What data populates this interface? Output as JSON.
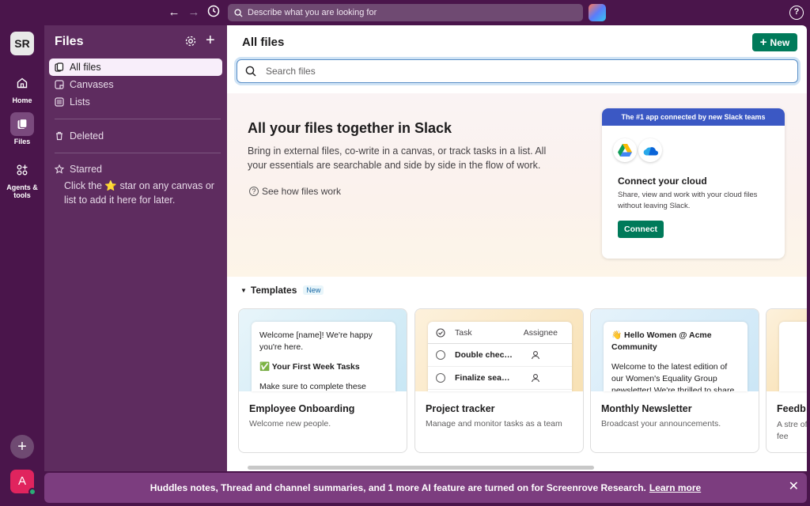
{
  "topbar": {
    "search_placeholder": "Describe what you are looking for",
    "help": "?"
  },
  "rail": {
    "user_initials": "SR",
    "home": "Home",
    "files": "Files",
    "agents": "Agents & tools",
    "plus": "+",
    "account_initial": "A"
  },
  "sidebar": {
    "title": "Files",
    "items": [
      {
        "label": "All files"
      },
      {
        "label": "Canvases"
      },
      {
        "label": "Lists"
      },
      {
        "label": "Deleted"
      },
      {
        "label": "Starred"
      }
    ],
    "starred_hint_pre": "Click the ",
    "starred_hint_star": "⭐",
    "starred_hint_post": " star on any canvas or list to add it here for later."
  },
  "main": {
    "title": "All files",
    "new_label": "New",
    "search_placeholder": "Search files",
    "hero": {
      "title": "All your files together in Slack",
      "desc": "Bring in external files, co-write in a canvas, or track tasks in a list. All your essentials are searchable and side by side in the flow of work.",
      "link": "See how files work"
    },
    "cloud_card": {
      "header": "The #1 app connected by new Slack teams",
      "title": "Connect your cloud",
      "desc": "Share, view and work with your cloud files without leaving Slack.",
      "button": "Connect"
    },
    "templates": {
      "label": "Templates",
      "badge": "New",
      "cards": [
        {
          "name": "Employee Onboarding",
          "desc": "Welcome new people.",
          "preview_line1": "Welcome [name]! We're happy you're here.",
          "preview_line2": "✅ Your First Week Tasks",
          "preview_line3": "Make sure to complete these tasks"
        },
        {
          "name": "Project tracker",
          "desc": "Manage and monitor tasks as a team",
          "col_task": "Task",
          "col_assignee": "Assignee",
          "rows": [
            "Double chec…",
            "Finalize sea…"
          ]
        },
        {
          "name": "Monthly Newsletter",
          "desc": "Broadcast your announcements.",
          "preview_line1": "👋 Hello Women @ Acme Community",
          "preview_line2": "Welcome to the latest edition of our Women's Equality Group newsletter! We're thrilled to share"
        },
        {
          "name": "Feedb",
          "desc": "A stre of fee"
        }
      ]
    }
  },
  "banner": {
    "text": "Huddles notes, Thread and channel summaries, and 1 more AI feature are turned on for Screenrove Research.",
    "link": "Learn more"
  }
}
